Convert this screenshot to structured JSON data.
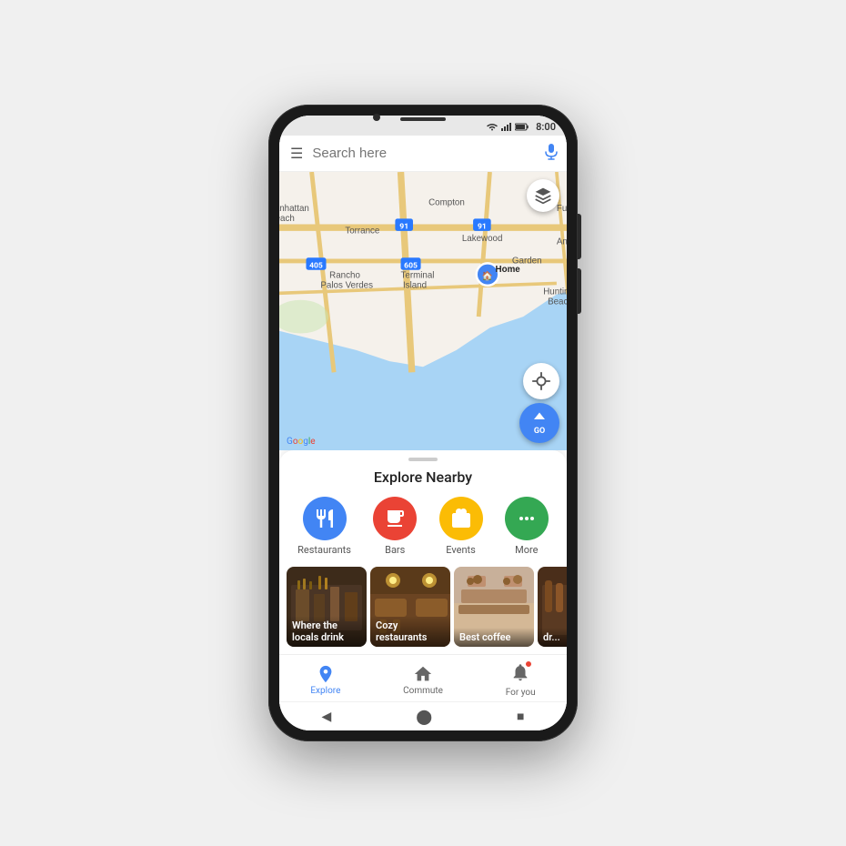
{
  "status_bar": {
    "time": "8:00"
  },
  "search": {
    "placeholder": "Search here"
  },
  "map": {
    "google_logo": [
      "G",
      "o",
      "o",
      "g",
      "l",
      "e"
    ]
  },
  "explore": {
    "title": "Explore Nearby",
    "categories": [
      {
        "id": "restaurants",
        "label": "Restaurants",
        "color": "#4285f4",
        "icon": "🍽"
      },
      {
        "id": "bars",
        "label": "Bars",
        "color": "#ea4335",
        "icon": "🍸"
      },
      {
        "id": "events",
        "label": "Events",
        "color": "#fbbc05",
        "icon": "🎟"
      },
      {
        "id": "more",
        "label": "More",
        "color": "#34a853",
        "icon": "···"
      }
    ],
    "cards": [
      {
        "id": "locals",
        "label": "Where the locals drink",
        "bg": "#5a3e2b"
      },
      {
        "id": "cozy",
        "label": "Cozy restaurants",
        "bg": "#7a4f2d"
      },
      {
        "id": "coffee",
        "label": "Best coffee",
        "bg": "#8a7060"
      },
      {
        "id": "drinks",
        "label": "dr...",
        "bg": "#6b4c3b"
      }
    ]
  },
  "bottom_nav": [
    {
      "id": "explore",
      "label": "Explore",
      "icon": "📍",
      "active": true,
      "color": "#4285f4"
    },
    {
      "id": "commute",
      "label": "Commute",
      "icon": "🏠",
      "active": false,
      "color": "#666"
    },
    {
      "id": "for_you",
      "label": "For you",
      "icon": "🔔",
      "active": false,
      "color": "#666"
    }
  ],
  "android_nav": {
    "back": "◀",
    "home": "⬤",
    "recents": "■"
  },
  "buttons": {
    "layers": "layers",
    "location": "⊙",
    "go": "GO",
    "menu": "☰",
    "mic": "🎤"
  }
}
